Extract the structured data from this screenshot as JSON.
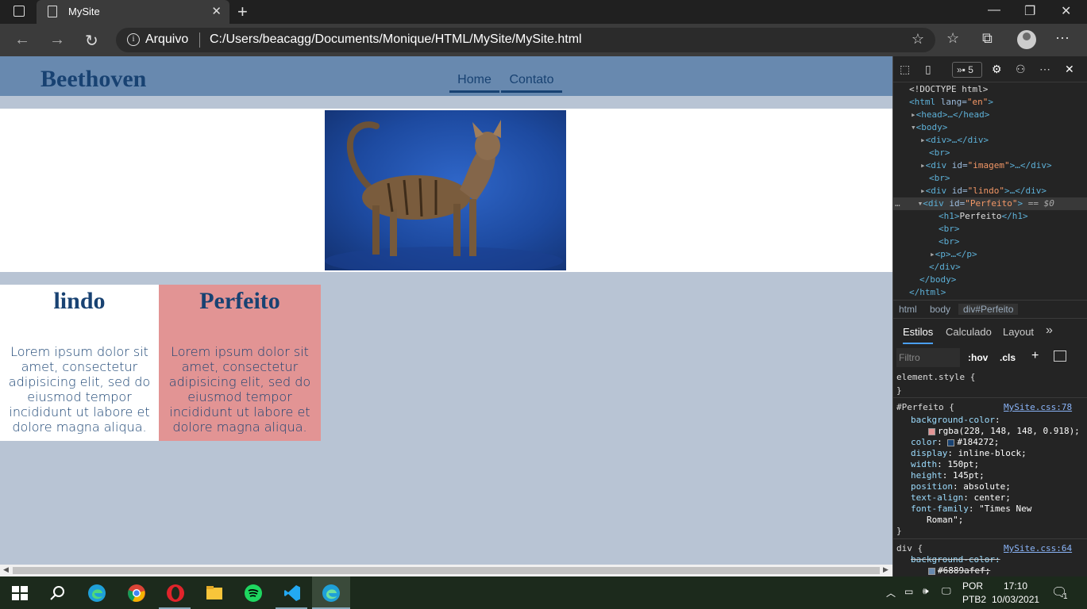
{
  "browser": {
    "tab_title": "MySite",
    "address_scheme": "Arquivo",
    "address_url": "C:/Users/beacagg/Documents/Monique/HTML/MySite/MySite.html"
  },
  "page": {
    "brand": "Beethoven",
    "nav": [
      "Home",
      "Contato"
    ],
    "box_lindo": {
      "title": "lindo",
      "text": "Lorem ipsum dolor sit amet, consectetur adipisicing elit, sed do eiusmod tempor incididunt ut labore et dolore magna aliqua."
    },
    "box_perfeito": {
      "title": "Perfeito",
      "text": "Lorem ipsum dolor sit amet, consectetur adipisicing elit, sed do eiusmod tempor incididunt ut labore et dolore magna aliqua."
    },
    "colors": {
      "header": "#6889af",
      "text": "#184272",
      "perfeito_bg": "#e29494",
      "page_bg": "#b8c4d4"
    }
  },
  "devtools": {
    "badge_count": "5",
    "dom_lines": {
      "doctype": "<!DOCTYPE html>",
      "html_open": "<html",
      "html_attr": " lang=",
      "html_val": "\"en\"",
      "html_close": ">",
      "head": "<head>…</head>",
      "body_open": "<body>",
      "div1": "<div>…</div>",
      "br": "<br>",
      "div_imagem_a": "<div",
      "id_attr": " id=",
      "imagem_val": "\"imagem\"",
      "div_imagem_b": ">…</div>",
      "lindo_val": "\"lindo\"",
      "perfeito_val": "\"Perfeito\"",
      "eq0": " == $0",
      "h1_open": "<h1>",
      "h1_text": "Perfeito",
      "h1_close": "</h1>",
      "p_line": "<p>…</p>",
      "div_close": "</div>",
      "body_close": "</body>",
      "html_end": "</html>",
      "gt": ">",
      "dots": "…"
    },
    "breadcrumbs": [
      "html",
      "body",
      "div#Perfeito"
    ],
    "style_tabs": [
      "Estilos",
      "Calculado",
      "Layout",
      "»"
    ],
    "filter_placeholder": "Filtro",
    "hov": ":hov",
    "cls": ".cls",
    "styles": {
      "element_style": "element.style {",
      "close_brace": "}",
      "perfeito_selector": "#Perfeito {",
      "perfeito_link": "MySite.css:78",
      "props": [
        {
          "name": "background-color",
          "value": "rgba(228, 148, 148, 0.918);"
        },
        {
          "name": "color",
          "value": "#184272;"
        },
        {
          "name": "display",
          "value": "inline-block;"
        },
        {
          "name": "width",
          "value": "150pt;"
        },
        {
          "name": "height",
          "value": "145pt;"
        },
        {
          "name": "position",
          "value": "absolute;"
        },
        {
          "name": "text-align",
          "value": "center;"
        },
        {
          "name": "font-family",
          "value": "\"Times New"
        }
      ],
      "font_family_cont": "Roman\";",
      "div_selector": "div {",
      "div_link": "MySite.css:64",
      "div_prop": "background-color:",
      "div_val": "#6889afef;"
    }
  },
  "taskbar": {
    "lang1": "POR",
    "lang2": "PTB2",
    "time": "17:10",
    "date": "10/03/2021",
    "notif": "1"
  }
}
